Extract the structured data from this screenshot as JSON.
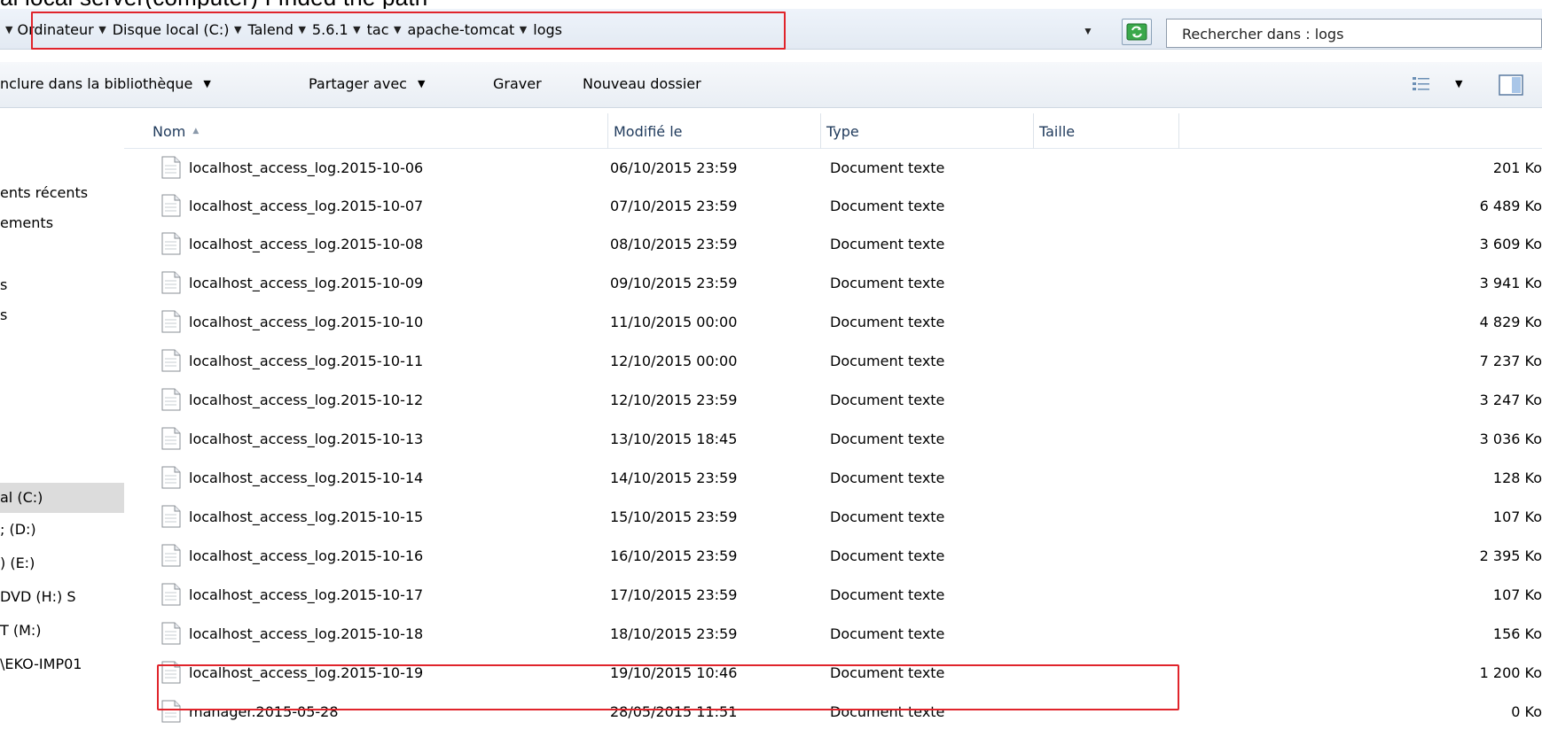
{
  "caption": "al local  server(computer)  I fnded the path",
  "addressbar": {
    "breadcrumb": [
      "Ordinateur",
      "Disque local (C:)",
      "Talend",
      "5.6.1",
      "tac",
      "apache-tomcat",
      "logs"
    ],
    "search_placeholder": "Rechercher dans : logs",
    "refresh_icon": "refresh-icon"
  },
  "toolbar": {
    "include_library": "nclure dans la bibliothèque",
    "share_with": "Partager avec",
    "burn": "Graver",
    "new_folder": "Nouveau dossier"
  },
  "nav_pane": {
    "items": [
      "ents récents",
      "ements",
      "s",
      "s",
      "al (C:)",
      "; (D:)",
      ") (E:)",
      "DVD (H:) S",
      "T (M:)",
      "\\EKO-IMP01"
    ]
  },
  "columns": {
    "name": "Nom",
    "modified": "Modifié le",
    "type": "Type",
    "size": "Taille"
  },
  "files": [
    {
      "name": "localhost_access_log.2015-10-06",
      "modified": "06/10/2015 23:59",
      "type": "Document texte",
      "size": "201 Ko"
    },
    {
      "name": "localhost_access_log.2015-10-07",
      "modified": "07/10/2015 23:59",
      "type": "Document texte",
      "size": "6 489 Ko"
    },
    {
      "name": "localhost_access_log.2015-10-08",
      "modified": "08/10/2015 23:59",
      "type": "Document texte",
      "size": "3 609 Ko"
    },
    {
      "name": "localhost_access_log.2015-10-09",
      "modified": "09/10/2015 23:59",
      "type": "Document texte",
      "size": "3 941 Ko"
    },
    {
      "name": "localhost_access_log.2015-10-10",
      "modified": "11/10/2015 00:00",
      "type": "Document texte",
      "size": "4 829 Ko"
    },
    {
      "name": "localhost_access_log.2015-10-11",
      "modified": "12/10/2015 00:00",
      "type": "Document texte",
      "size": "7 237 Ko"
    },
    {
      "name": "localhost_access_log.2015-10-12",
      "modified": "12/10/2015 23:59",
      "type": "Document texte",
      "size": "3 247 Ko"
    },
    {
      "name": "localhost_access_log.2015-10-13",
      "modified": "13/10/2015 18:45",
      "type": "Document texte",
      "size": "3 036 Ko"
    },
    {
      "name": "localhost_access_log.2015-10-14",
      "modified": "14/10/2015 23:59",
      "type": "Document texte",
      "size": "128 Ko"
    },
    {
      "name": "localhost_access_log.2015-10-15",
      "modified": "15/10/2015 23:59",
      "type": "Document texte",
      "size": "107 Ko"
    },
    {
      "name": "localhost_access_log.2015-10-16",
      "modified": "16/10/2015 23:59",
      "type": "Document texte",
      "size": "2 395 Ko"
    },
    {
      "name": "localhost_access_log.2015-10-17",
      "modified": "17/10/2015 23:59",
      "type": "Document texte",
      "size": "107 Ko"
    },
    {
      "name": "localhost_access_log.2015-10-18",
      "modified": "18/10/2015 23:59",
      "type": "Document texte",
      "size": "156 Ko"
    },
    {
      "name": "localhost_access_log.2015-10-19",
      "modified": "19/10/2015 10:46",
      "type": "Document texte",
      "size": "1 200 Ko"
    },
    {
      "name": "manager.2015-05-28",
      "modified": "28/05/2015 11:51",
      "type": "Document texte",
      "size": "0 Ko"
    }
  ],
  "colors": {
    "highlight_box": "#e0242b",
    "header_text": "#1e395b",
    "selected_nav": "#dcdcdc"
  }
}
